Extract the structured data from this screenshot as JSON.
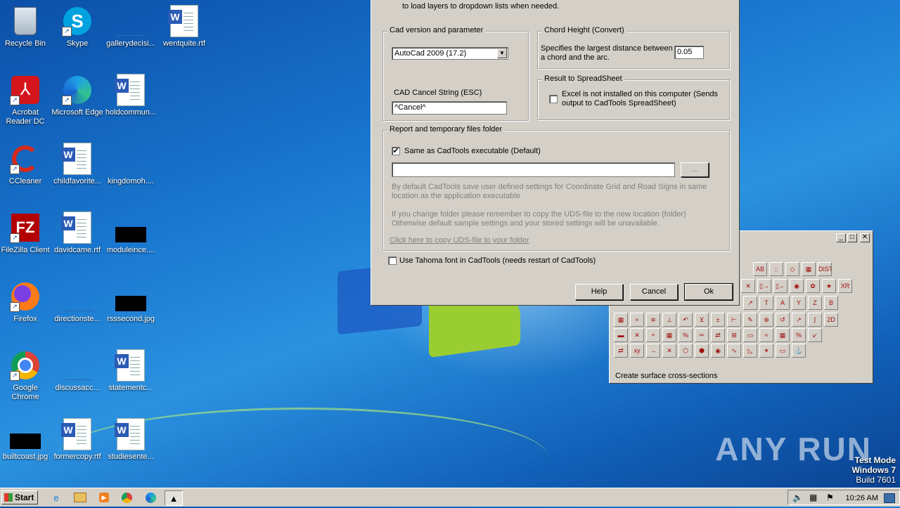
{
  "desktop": {
    "icons": [
      {
        "label": "Recycle Bin",
        "icon": "recycle-bin-icon"
      },
      {
        "label": "Skype",
        "icon": "skype-icon"
      },
      {
        "label": "gallerydecisi...",
        "icon": "blank-file-icon"
      },
      {
        "label": "wentquite.rtf",
        "icon": "word-document-icon"
      },
      {
        "label": "Acrobat Reader DC",
        "icon": "acrobat-icon"
      },
      {
        "label": "Microsoft Edge",
        "icon": "edge-icon"
      },
      {
        "label": "holdcommun...",
        "icon": "word-document-icon"
      },
      {
        "label": "CCleaner",
        "icon": "ccleaner-icon"
      },
      {
        "label": "childfavorite...",
        "icon": "word-document-icon"
      },
      {
        "label": "kingdomoh....",
        "icon": "blank-file-icon"
      },
      {
        "label": "FileZilla Client",
        "icon": "filezilla-icon"
      },
      {
        "label": "davidcame.rtf",
        "icon": "word-document-icon"
      },
      {
        "label": "moduleince....",
        "icon": "image-file-icon"
      },
      {
        "label": "Firefox",
        "icon": "firefox-icon"
      },
      {
        "label": "directionste...",
        "icon": "blank-file-icon"
      },
      {
        "label": "rsssecond.jpg",
        "icon": "image-file-icon"
      },
      {
        "label": "Google Chrome",
        "icon": "chrome-icon"
      },
      {
        "label": "discussacc...",
        "icon": "blank-file-icon"
      },
      {
        "label": "statementc...",
        "icon": "word-document-icon"
      },
      {
        "label": "builtcoast.jpg",
        "icon": "image-file-icon"
      },
      {
        "label": "formercopy.rtf",
        "icon": "word-document-icon"
      },
      {
        "label": "studiesente...",
        "icon": "word-document-icon"
      }
    ]
  },
  "dialog": {
    "top_text": "to load layers to dropdown lists when needed.",
    "cad_group_title": "Cad version and parameter",
    "cad_version_value": "AutoCad 2009 (17.2)",
    "cancel_string_label": "CAD Cancel String (ESC)",
    "cancel_string_value": "^Cancel^",
    "chord_group_title": "Chord Height (Convert)",
    "chord_desc": "Specifies the largest distance between a chord and the arc.",
    "chord_value": "0.05",
    "spreadsheet_group_title": "Result to SpreadSheet",
    "excel_checkbox_label": "Excel is not installed on this computer (Sends output to CadTools SpreadSheet)",
    "report_group_title": "Report and temporary files folder",
    "same_as_exe_label": "Same as CadTools executable (Default)",
    "folder_path_value": "",
    "browse_label": "...",
    "info_text_1": "By default CadTools save user defined settings for Coordinate Grid and Road Signs in same location as the application executable",
    "info_text_2": "If you change folder please remember to copy the UDS-file to the new location (folder) Otherwise default sample settings and your stored settings will be unavailable.",
    "copy_uds_link": "Click here to copy UDS-file to your folder",
    "tahoma_label": "Use Tahoma font in CadTools (needs restart of CadTools)",
    "help_label": "Help",
    "cancel_label": "Cancel",
    "ok_label": "Ok"
  },
  "toolwindow": {
    "status": "Create surface cross-sections",
    "row1": [
      "AB",
      "::",
      "◇",
      "▦",
      "DIST"
    ],
    "row2": [
      "→",
      "✕",
      "▯→",
      "▯←",
      "◉",
      "✿",
      "★",
      "XR"
    ],
    "row3": [
      "↗",
      "T",
      "A",
      "Y",
      "Z",
      "B"
    ],
    "row4": [
      "▦",
      "≈",
      "≋",
      "⊥",
      "↶",
      "⊻",
      "±",
      "⊢",
      "✎",
      "⊕",
      "↺",
      "↗",
      "∫",
      "2D"
    ],
    "row5": [
      "▬",
      "✕",
      "+",
      "▦",
      "%",
      "✂",
      "⇄",
      "⊞",
      "▭",
      "≈",
      "▦",
      "%",
      "↙"
    ],
    "row6": [
      "⇄",
      "xy",
      "→",
      "✕",
      "⬡",
      "⬢",
      "◉",
      "∿",
      "◺",
      "✶",
      "▭",
      "⚓"
    ]
  },
  "taskbar": {
    "start_label": "Start",
    "clock": "10:26 AM",
    "items": [
      "ie-icon",
      "explorer-icon",
      "media-player-icon",
      "chrome-icon",
      "edge-icon",
      "cadtools-icon"
    ]
  },
  "overlay": {
    "watermark": "ANY RUN",
    "testmode_line1": "Test Mode",
    "testmode_line2": "Windows 7",
    "testmode_line3": "Build 7601"
  }
}
